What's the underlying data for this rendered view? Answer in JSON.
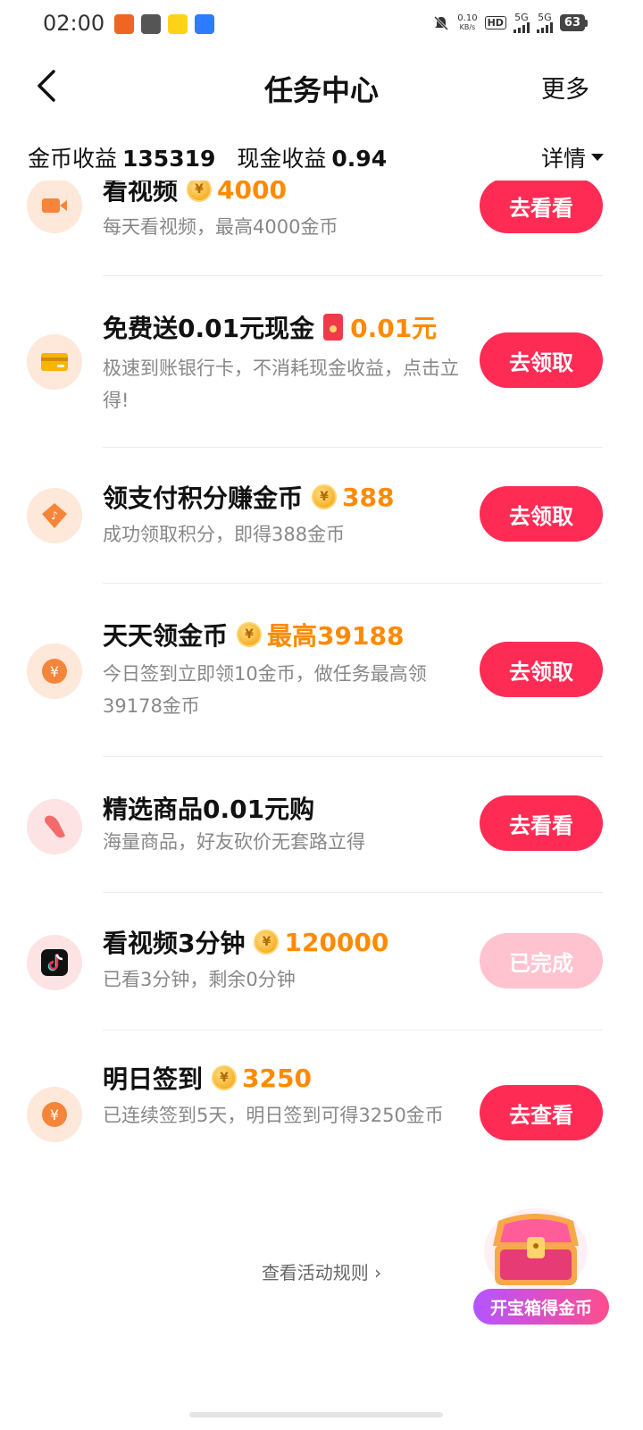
{
  "status_bar": {
    "time": "02:00",
    "net_speed_value": "0.10",
    "net_speed_unit": "KB/s",
    "hd": "HD",
    "signal_1": "5G",
    "signal_2": "5G",
    "battery": "63"
  },
  "header": {
    "title": "任务中心",
    "more": "更多"
  },
  "earnings": {
    "coin_label": "金币收益",
    "coin_value": "135319",
    "cash_label": "现金收益",
    "cash_value": "0.94",
    "detail": "详情"
  },
  "tasks": [
    {
      "title": "看视频",
      "reward": "4000",
      "desc": "每天看视频，最高4000金币",
      "button": "去看看",
      "icon": "video-camera-icon"
    },
    {
      "title": "免费送0.01元现金",
      "reward": "0.01元",
      "desc": "极速到账银行卡，不消耗现金收益，点击立得!",
      "button": "去领取",
      "icon": "bank-card-icon"
    },
    {
      "title": "领支付积分赚金币",
      "reward": "388",
      "desc": "成功领取积分，即得388金币",
      "button": "去领取",
      "icon": "points-diamond-icon"
    },
    {
      "title": "天天领金币",
      "reward": "最高39188",
      "desc": "今日签到立即领10金币，做任务最高领39178金币",
      "button": "去领取",
      "icon": "yuan-coin-icon"
    },
    {
      "title": "精选商品0.01元购",
      "reward": "",
      "desc": "海量商品，好友砍价无套路立得",
      "button": "去看看",
      "icon": "shopping-tag-icon"
    },
    {
      "title": "看视频3分钟",
      "reward": "120000",
      "desc": "已看3分钟，剩余0分钟",
      "button": "已完成",
      "icon": "tiktok-icon"
    },
    {
      "title": "明日签到",
      "reward": "3250",
      "desc": "已连续签到5天，明日签到可得3250金币",
      "button": "去查看",
      "icon": "yuan-coin-icon"
    }
  ],
  "footer": {
    "rules": "查看活动规则 ›",
    "treasure": "开宝箱得金币"
  },
  "colors": {
    "primary": "#fe2c55",
    "primary_disabled": "#ffc3cf",
    "reward": "#ff8a00",
    "icon_bg": "#fde8d9"
  }
}
